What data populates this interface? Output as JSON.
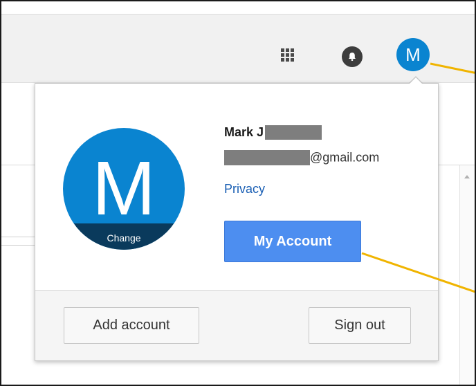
{
  "header": {
    "apps_icon": "apps-grid-icon",
    "notifications_icon": "bell-icon",
    "avatar_letter": "M"
  },
  "account_popup": {
    "avatar_letter": "M",
    "change_label": "Change",
    "name_visible": "Mark J",
    "email_suffix": "@gmail.com",
    "privacy_label": "Privacy",
    "my_account_label": "My Account",
    "add_account_label": "Add account",
    "sign_out_label": "Sign out"
  },
  "colors": {
    "avatar_blue": "#0a84d0",
    "change_strip": "#0a3a5c",
    "primary_button": "#4d8ef0",
    "link": "#1a5fb4",
    "callout_line": "#f0b400",
    "redaction": "#7e7e7e"
  }
}
